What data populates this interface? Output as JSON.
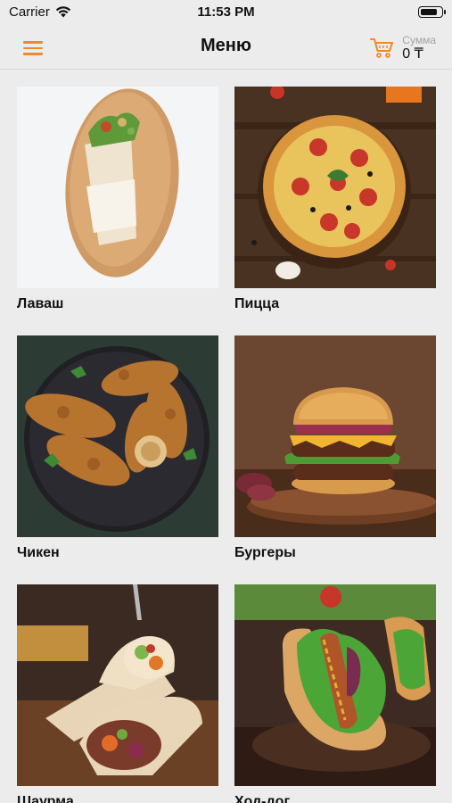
{
  "status": {
    "carrier": "Carrier",
    "time": "11:53 PM",
    "battery_level": 0.85
  },
  "nav": {
    "title": "Меню",
    "cart_label": "Сумма",
    "cart_total": "0 ₸"
  },
  "icons": {
    "menu": "hamburger-menu-icon",
    "cart": "shopping-cart-icon",
    "wifi": "wifi-icon",
    "battery": "battery-icon"
  },
  "colors": {
    "accent": "#f08a24",
    "background": "#ececec"
  },
  "categories": [
    {
      "label": "Лаваш"
    },
    {
      "label": "Пицца"
    },
    {
      "label": "Чикен"
    },
    {
      "label": "Бургеры"
    },
    {
      "label": "Шаурма"
    },
    {
      "label": "Ход-дог"
    }
  ]
}
